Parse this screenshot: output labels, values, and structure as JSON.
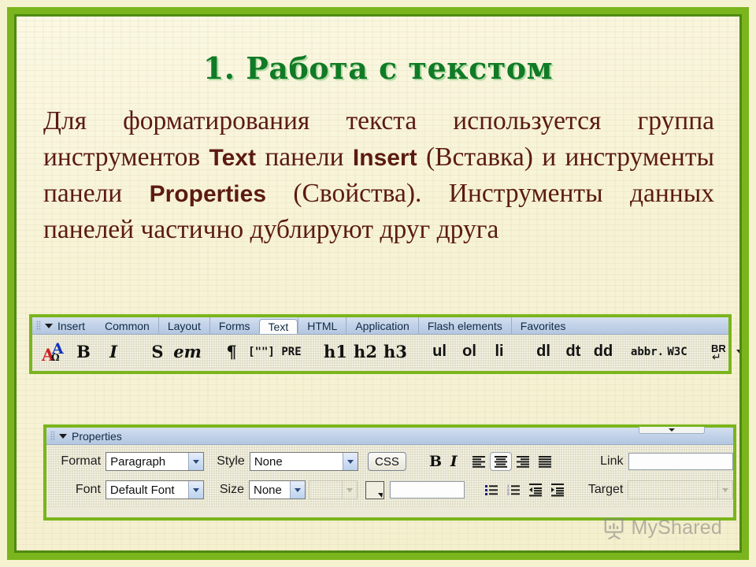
{
  "slide": {
    "title": "1. Работа с текстом",
    "body": {
      "seg1": "Для форматирования текста используется группа инструментов ",
      "en1": "Text",
      "seg2": " панели ",
      "en2": "Insert",
      "seg3": " (Вставка) и инструменты панели ",
      "en3": "Properties",
      "seg4": " (Свойства). Инструменты данных панелей частично дублируют друг друга"
    },
    "colors": {
      "frame_green": "#7ab51d",
      "frame_green_dark": "#4f8a12",
      "title_green": "#117a26",
      "body_brown": "#5b1a12",
      "paper": "#f7f3d6"
    }
  },
  "insert_panel": {
    "title": "Insert",
    "collapse_icon": "triangle-down-icon",
    "gripper_icon": "drag-gripper-icon",
    "tabs": [
      {
        "label": "Common",
        "active": false
      },
      {
        "label": "Layout",
        "active": false
      },
      {
        "label": "Forms",
        "active": false
      },
      {
        "label": "Text",
        "active": true
      },
      {
        "label": "HTML",
        "active": false
      },
      {
        "label": "Application",
        "active": false
      },
      {
        "label": "Flash elements",
        "active": false
      },
      {
        "label": "Favorites",
        "active": false
      }
    ],
    "buttons": [
      {
        "label": "AАΩ",
        "name": "characters-icon",
        "kind": "az"
      },
      {
        "label": "B",
        "name": "bold-button",
        "kind": "serif"
      },
      {
        "label": "I",
        "name": "italic-button",
        "kind": "serif-italic"
      },
      {
        "sep": true
      },
      {
        "label": "S",
        "name": "strong-button",
        "kind": "serif"
      },
      {
        "label": "em",
        "name": "emphasis-button",
        "kind": "serif-italic"
      },
      {
        "sep": true
      },
      {
        "label": "¶",
        "name": "paragraph-button",
        "kind": "serif"
      },
      {
        "label": "[\"\"]",
        "name": "blockquote-button",
        "kind": "mono"
      },
      {
        "label": "PRE",
        "name": "preformatted-button",
        "kind": "mono"
      },
      {
        "sep": true
      },
      {
        "label": "h1",
        "name": "heading1-button",
        "kind": "serif"
      },
      {
        "label": "h2",
        "name": "heading2-button",
        "kind": "serif"
      },
      {
        "label": "h3",
        "name": "heading3-button",
        "kind": "serif"
      },
      {
        "sep": true
      },
      {
        "label": "ul",
        "name": "unordered-list-button",
        "kind": "sans"
      },
      {
        "label": "ol",
        "name": "ordered-list-button",
        "kind": "sans"
      },
      {
        "label": "li",
        "name": "list-item-button",
        "kind": "sans"
      },
      {
        "sep": true
      },
      {
        "label": "dl",
        "name": "definition-list-button",
        "kind": "sans"
      },
      {
        "label": "dt",
        "name": "definition-term-button",
        "kind": "sans"
      },
      {
        "label": "dd",
        "name": "definition-desc-button",
        "kind": "sans"
      },
      {
        "sep": true
      },
      {
        "label": "abbr.",
        "name": "abbreviation-button",
        "kind": "mono"
      },
      {
        "label": "W3C",
        "name": "acronym-button",
        "kind": "mono"
      },
      {
        "sep": true
      },
      {
        "label": "BR",
        "name": "line-break-icon",
        "kind": "br"
      }
    ]
  },
  "properties_panel": {
    "title": "Properties",
    "collapse_icon": "triangle-down-icon",
    "handle_icon": "panel-handle-arrow-icon",
    "row1": {
      "format_label": "Format",
      "format_value": "Paragraph",
      "style_label": "Style",
      "style_value": "None",
      "css_button": "CSS",
      "bold": "B",
      "italic": "I",
      "align": [
        {
          "name": "align-left-icon",
          "selected": false
        },
        {
          "name": "align-center-icon",
          "selected": true
        },
        {
          "name": "align-right-icon",
          "selected": false
        },
        {
          "name": "align-justify-icon",
          "selected": false
        }
      ],
      "link_label": "Link",
      "link_value": ""
    },
    "row2": {
      "font_label": "Font",
      "font_value": "Default Font",
      "size_label": "Size",
      "size_value": "None",
      "unit_value": "",
      "color_swatch": "text-color-swatch",
      "color_value": "",
      "lists": [
        {
          "name": "unordered-list-icon"
        },
        {
          "name": "ordered-list-icon"
        },
        {
          "name": "outdent-icon"
        },
        {
          "name": "indent-icon"
        }
      ],
      "target_label": "Target",
      "target_value": ""
    }
  },
  "watermark": {
    "text": "MyShared",
    "icon": "presentation-screen-icon"
  }
}
